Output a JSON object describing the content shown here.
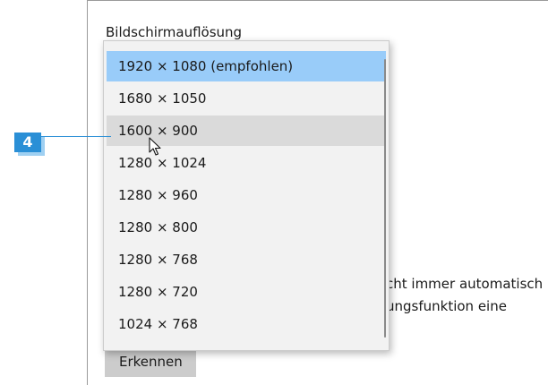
{
  "display_settings": {
    "section_title": "Bildschirmauflösung",
    "resolution_options": [
      {
        "label": "1920 × 1080 (empfohlen)",
        "state": "selected"
      },
      {
        "label": "1680 × 1050",
        "state": "normal"
      },
      {
        "label": "1600 × 900",
        "state": "hover"
      },
      {
        "label": "1280 × 1024",
        "state": "normal"
      },
      {
        "label": "1280 × 960",
        "state": "normal"
      },
      {
        "label": "1280 × 800",
        "state": "normal"
      },
      {
        "label": "1280 × 768",
        "state": "normal"
      },
      {
        "label": "1280 × 720",
        "state": "normal"
      },
      {
        "label": "1024 × 768",
        "state": "normal"
      }
    ],
    "body_text_line1": "cht immer automatisch",
    "body_text_line2": "ungsfunktion eine",
    "detect_button_label": "Erkennen"
  },
  "callout": {
    "number": "4"
  },
  "colors": {
    "selected_bg": "#99ccf9",
    "hover_bg": "#dadada",
    "callout_blue": "#2a8fd6"
  },
  "icons": {
    "cursor": "mouse-pointer-icon"
  }
}
